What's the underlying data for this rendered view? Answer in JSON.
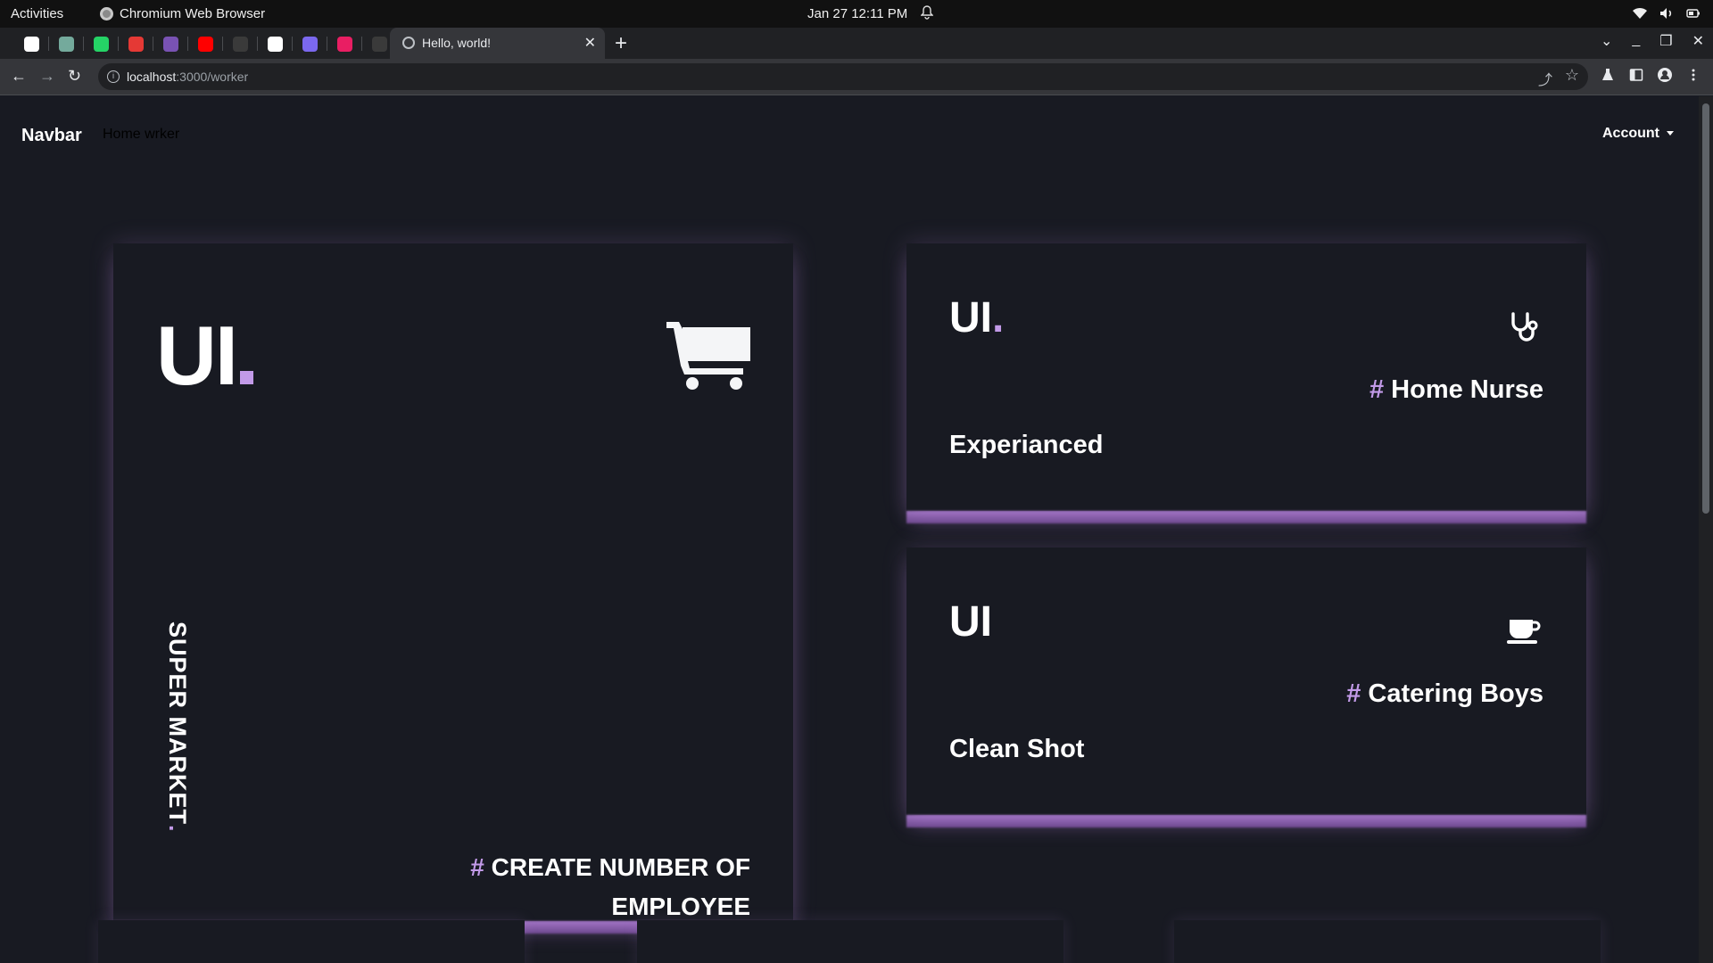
{
  "os": {
    "activities": "Activities",
    "app_name": "Chromium Web Browser",
    "clock": "Jan 27  12:11 PM"
  },
  "browser": {
    "pinned_tabs": [
      {
        "icon": "github-icon",
        "color": "#ffffff"
      },
      {
        "icon": "chatgpt-icon",
        "color": "#74aa9c"
      },
      {
        "icon": "whatsapp-icon",
        "color": "#25d366"
      },
      {
        "icon": "target-icon",
        "color": "#e53935"
      },
      {
        "icon": "bootstrap-icon",
        "color": "#7952b3"
      },
      {
        "icon": "youtube-icon",
        "color": "#ff0000"
      },
      {
        "icon": "cursor-icon",
        "color": "#3a3a3a"
      },
      {
        "icon": "shield-icon",
        "color": "#ffffff"
      },
      {
        "icon": "ui-icon",
        "color": "#7b68ee"
      },
      {
        "icon": "media-icon",
        "color": "#e91e63"
      },
      {
        "icon": "cursor-icon",
        "color": "#3a3a3a"
      }
    ],
    "active_tab": {
      "title": "Hello, world!"
    },
    "url_host": "localhost",
    "url_path": ":3000/worker"
  },
  "navbar": {
    "brand": "Navbar",
    "link": "Home wrker",
    "account": "Account"
  },
  "cards": {
    "main": {
      "logo": "UI",
      "vertical_text": "SUPER MARKET",
      "hash": "#",
      "tag": "CREATE NUMBER OF EMPLOYEE",
      "icon": "cart-icon"
    },
    "nurse": {
      "logo": "UI",
      "logo_dot": ".",
      "hash": "#",
      "tag": "Home Nurse",
      "desc": "Experianced",
      "icon": "stethoscope-icon"
    },
    "catering": {
      "logo": "UI",
      "hash": "#",
      "tag": "Catering Boys",
      "desc": "Clean Shot",
      "icon": "coffee-cup-icon"
    }
  },
  "colors": {
    "accent": "#c29ae8",
    "background": "#181a22",
    "text": "#ffffff"
  }
}
